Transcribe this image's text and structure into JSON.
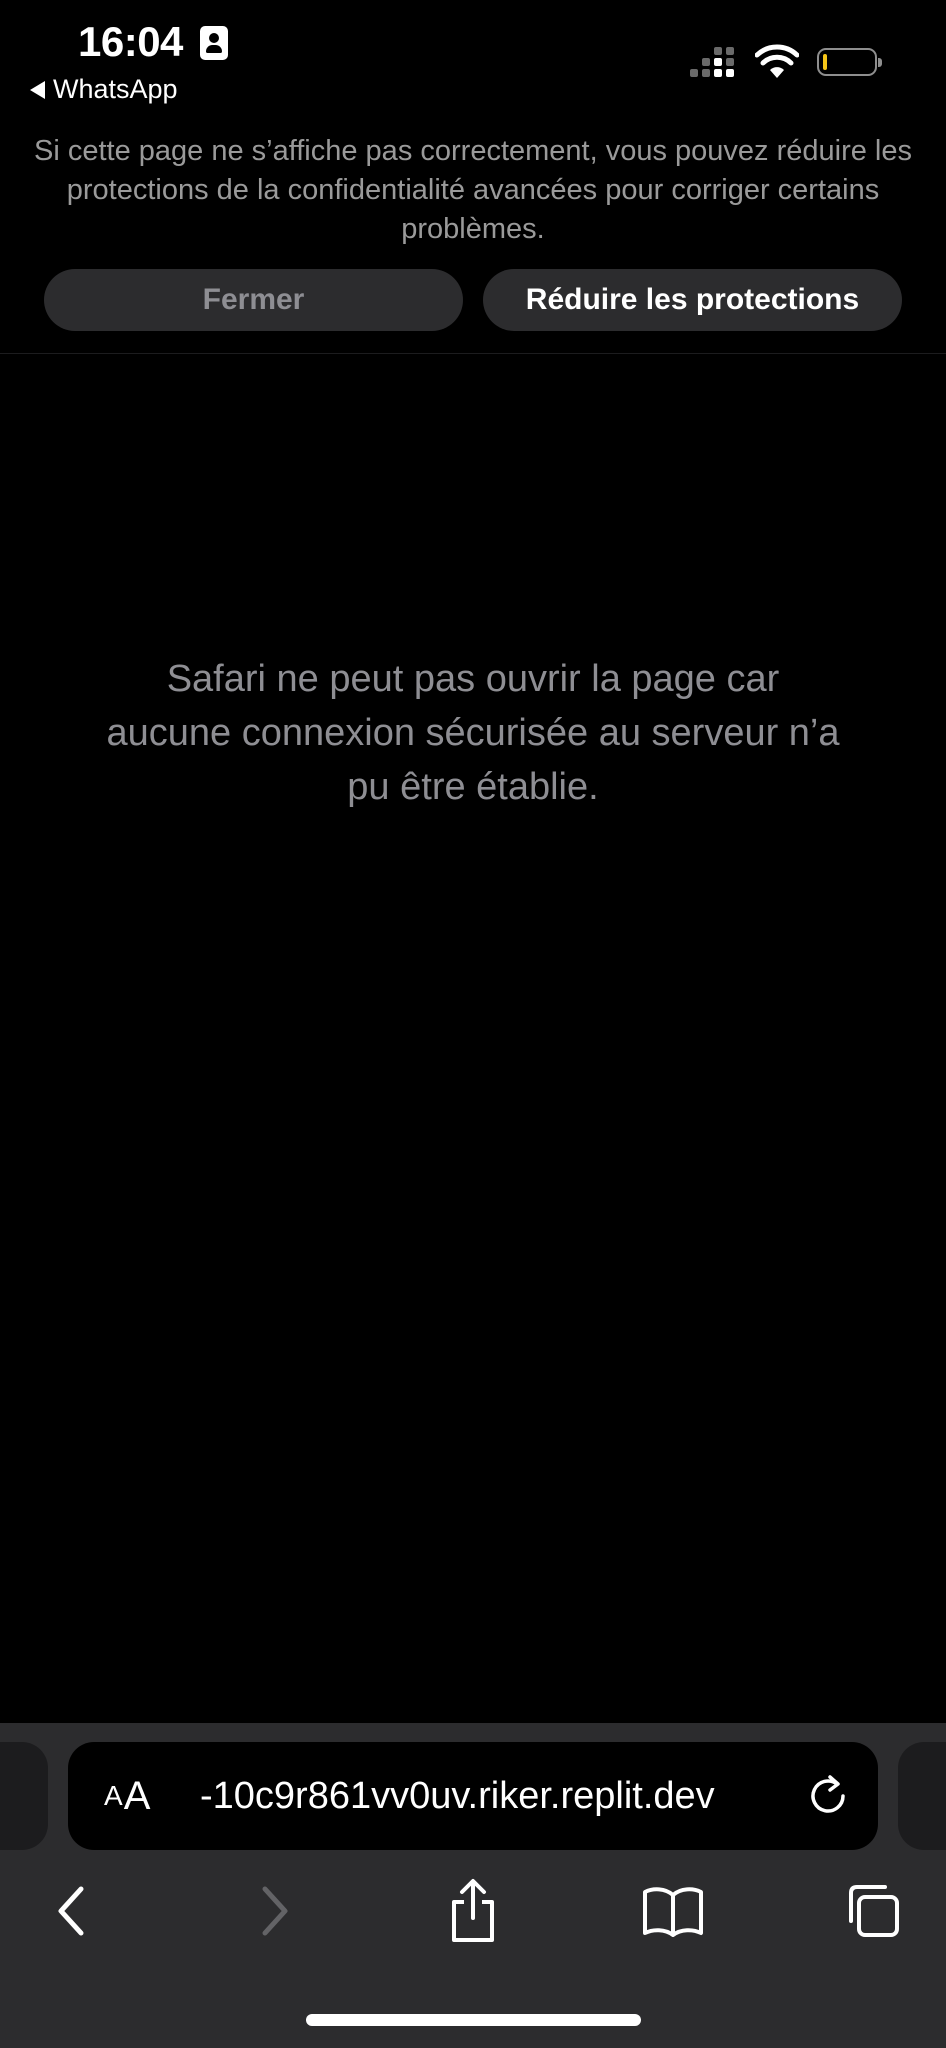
{
  "status_bar": {
    "time": "16:04",
    "back_app": "WhatsApp"
  },
  "privacy_banner": {
    "message": "Si cette page ne s’affiche pas correctement, vous pouvez réduire les protections de la confidentialité avancées pour corriger certains problèmes.",
    "close_label": "Fermer",
    "reduce_label": "Réduire les protections"
  },
  "error": {
    "message": "Safari ne peut pas ouvrir la page car aucune connexion sécurisée au serveur n’a pu être établie."
  },
  "address_bar": {
    "aa_small": "A",
    "aa_large": "A",
    "url": "-10c9r861vv0uv.riker.replit.dev"
  },
  "icons": {
    "back": "chevron-left-icon",
    "forward": "chevron-right-icon",
    "share": "share-icon",
    "bookmarks": "book-icon",
    "tabs": "tabs-icon",
    "reload": "reload-icon"
  },
  "colors": {
    "background": "#000000",
    "toolbar": "#2c2c2e",
    "battery_level": "#f5c518",
    "muted_text": "#8e8e93"
  }
}
